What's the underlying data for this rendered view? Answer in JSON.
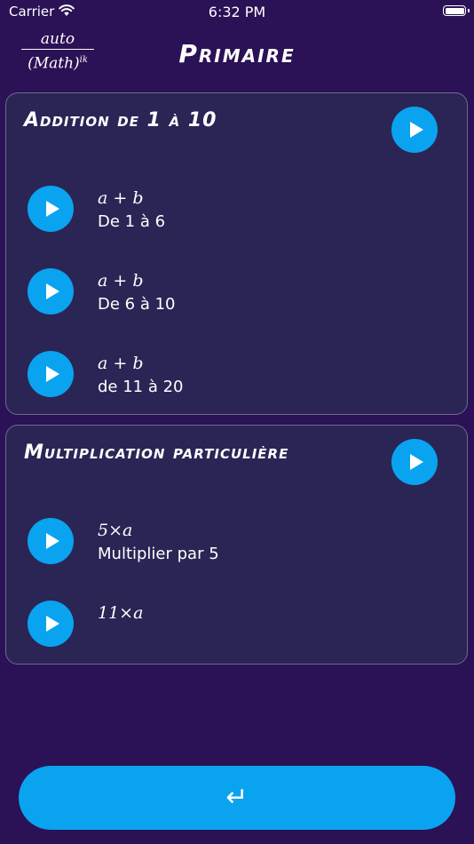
{
  "status": {
    "carrier": "Carrier",
    "time": "6:32 PM"
  },
  "header": {
    "logo_top": "auto",
    "logo_bottom": "(Math)",
    "logo_sup": "ik",
    "title": "Primaire"
  },
  "sections": [
    {
      "title": "Addition de 1 à 10",
      "items": [
        {
          "formula": "a + b",
          "label": "De 1 à 6"
        },
        {
          "formula": "a + b",
          "label": "De 6 à 10"
        },
        {
          "formula": "a + b",
          "label": "de 11 à 20"
        }
      ]
    },
    {
      "title": "Multiplication particulière",
      "items": [
        {
          "formula": "5×a",
          "label": "Multiplier par 5"
        },
        {
          "formula": "11×a",
          "label": ""
        }
      ]
    }
  ],
  "footer": {
    "back_icon": "return-arrow-icon",
    "back_glyph": "↵"
  },
  "colors": {
    "background": "#2b1155",
    "card": "#2a2555",
    "accent": "#0aa3f0"
  }
}
